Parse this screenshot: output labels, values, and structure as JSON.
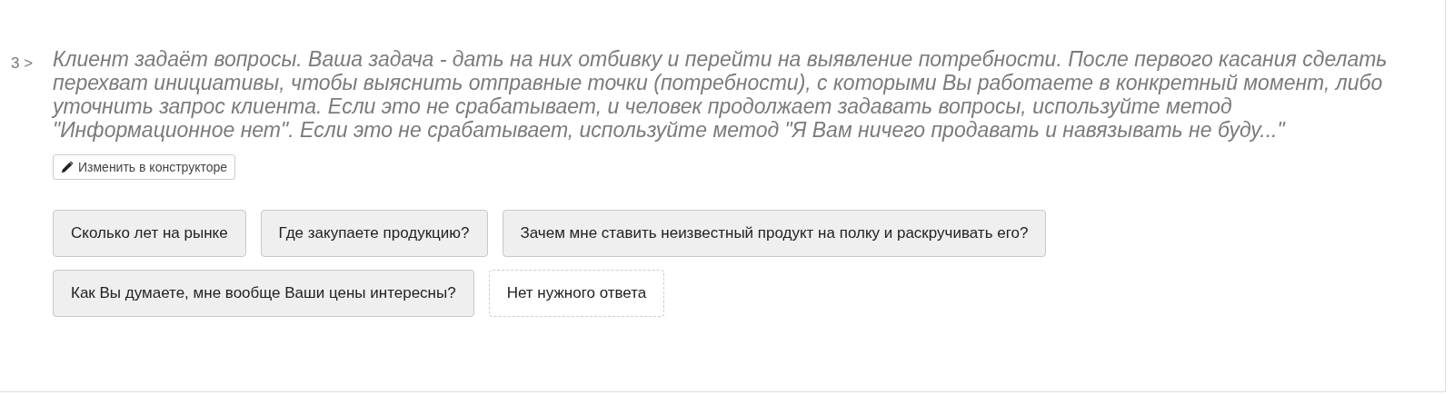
{
  "question": {
    "number": "3 >",
    "text": "Клиент задаёт вопросы. Ваша задача - дать на них отбивку и перейти на выявление потребности. После первого касания сделать перехват инициативы, чтобы выяснить отправные точки (потребности), с которыми Вы работаете в конкретный момент, либо уточнить запрос клиента. Если это не срабатывает, и человек продолжает задавать вопросы, используйте метод \"Информационное нет\". Если это не срабатывает, используйте метод \"Я Вам ничего продавать и навязывать не буду...\"",
    "edit_button": "Изменить в конструкторе"
  },
  "answers": [
    {
      "label": "Сколько лет на рынке",
      "kind": "answer"
    },
    {
      "label": "Где закупаете продукцию?",
      "kind": "answer"
    },
    {
      "label": "Зачем мне ставить неизвестный продукт на полку и раскручивать его?",
      "kind": "answer"
    },
    {
      "label": "Как Вы думаете, мне вообще Ваши цены интересны?",
      "kind": "answer"
    },
    {
      "label": "Нет нужного ответа",
      "kind": "none"
    }
  ]
}
